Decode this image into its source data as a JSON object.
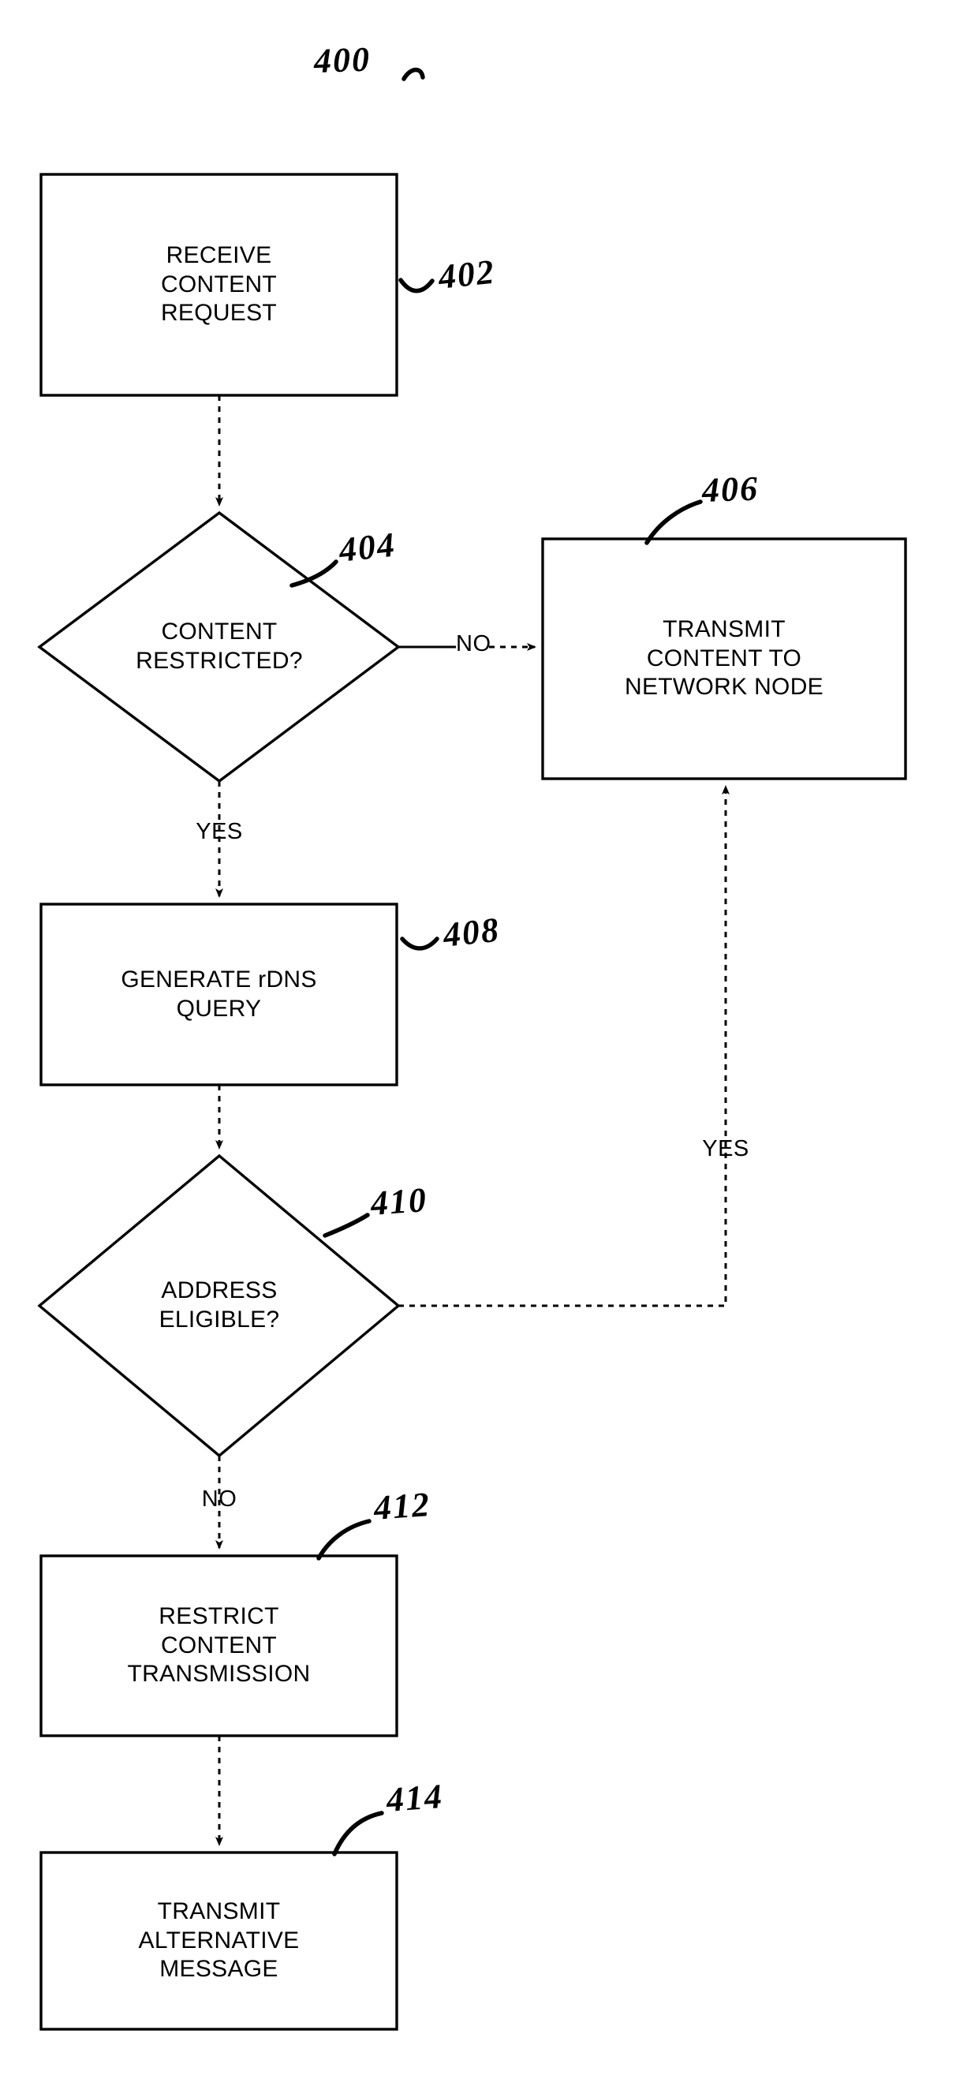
{
  "figure": {
    "number": "400",
    "type": "patent-flowchart",
    "title_label": "400"
  },
  "nodes": [
    {
      "id": "n402",
      "ref": "402",
      "shape": "process",
      "lines": [
        "RECEIVE",
        "CONTENT",
        "REQUEST"
      ]
    },
    {
      "id": "n404",
      "ref": "404",
      "shape": "decision",
      "lines": [
        "CONTENT",
        "RESTRICTED?"
      ]
    },
    {
      "id": "n406",
      "ref": "406",
      "shape": "process",
      "lines": [
        "TRANSMIT",
        "CONTENT TO",
        "NETWORK NODE"
      ]
    },
    {
      "id": "n408",
      "ref": "408",
      "shape": "process",
      "lines": [
        "GENERATE rDNS",
        "QUERY"
      ]
    },
    {
      "id": "n410",
      "ref": "410",
      "shape": "decision",
      "lines": [
        "ADDRESS",
        "ELIGIBLE?"
      ]
    },
    {
      "id": "n412",
      "ref": "412",
      "shape": "process",
      "lines": [
        "RESTRICT",
        "CONTENT",
        "TRANSMISSION"
      ]
    },
    {
      "id": "n414",
      "ref": "414",
      "shape": "process",
      "lines": [
        "TRANSMIT",
        "ALTERNATIVE",
        "MESSAGE"
      ]
    }
  ],
  "edge_labels": {
    "no_from_404": "NO",
    "yes_from_404": "YES",
    "yes_from_410": "YES",
    "no_from_410": "NO"
  },
  "colors": {
    "ink": "#000000",
    "paper": "#ffffff"
  }
}
